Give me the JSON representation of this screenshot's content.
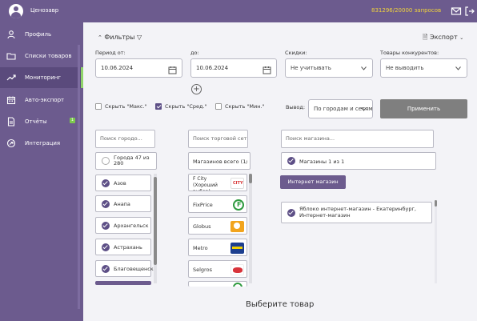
{
  "header": {
    "app_name": "Ценозавр",
    "quota": "831296/20000 запросов",
    "icons": [
      "logo-icon",
      "mail-icon",
      "logout-icon"
    ]
  },
  "sidebar": {
    "items": [
      {
        "label": "Профиль",
        "icon": "user-icon",
        "active": false
      },
      {
        "label": "Списки товаров",
        "icon": "folder-icon",
        "active": false
      },
      {
        "label": "Мониторинг",
        "icon": "chart-icon",
        "active": true
      },
      {
        "label": "Авто-экспорт",
        "icon": "calendar-icon",
        "active": false
      },
      {
        "label": "Отчёты",
        "icon": "document-icon",
        "active": false,
        "badge": "1"
      },
      {
        "label": "Интеграция",
        "icon": "integration-icon",
        "active": false
      }
    ]
  },
  "filters": {
    "title": "Фильтры",
    "export_label": "Экспорт",
    "period_from_label": "Период от:",
    "period_from_value": "10.06.2024",
    "period_to_label": "до:",
    "period_to_value": "10.06.2024",
    "discounts_label": "Скидки:",
    "discounts_value": "Не учитывать",
    "competitors_label": "Товары конкурентов:",
    "competitors_value": "Не выводить",
    "hide_max": "Скрыть \"Макс.\"",
    "hide_avg": "Скрыть \"Сред.\"",
    "hide_min": "Скрыть \"Мин.\"",
    "hide_max_checked": false,
    "hide_avg_checked": true,
    "hide_min_checked": false,
    "output_label": "Вывод:",
    "output_value": "По городам и сетям",
    "apply_label": "Применить"
  },
  "cities": {
    "search_placeholder": "Поиск городо...",
    "summary": "Города 47 из 280",
    "items": [
      "Азов",
      "Анапа",
      "Архангельск",
      "Астрахань",
      "Благовещенск"
    ]
  },
  "networks": {
    "search_placeholder": "Поиск торговой сети",
    "summary": "Магазинов всего (1/1)",
    "items": [
      {
        "name": "F City (Хороший выбор)",
        "logo_color": "#ffffff"
      },
      {
        "name": "FixPrice",
        "logo_color": "#2e9a3f"
      },
      {
        "name": "Globus",
        "logo_color": "#f2a41d"
      },
      {
        "name": "Metro",
        "logo_color": "#1d3f8f"
      },
      {
        "name": "Selgros",
        "logo_color": "#d8333a"
      }
    ]
  },
  "shops": {
    "search_placeholder": "Поиск магазина...",
    "summary": "Магазины 1 из 1",
    "online_button": "Интернет магазин",
    "items": [
      "Яблоко интернет-магазин - Екатеринбург, Интернет-магазин"
    ]
  },
  "footer": {
    "title": "Выберите товар"
  }
}
